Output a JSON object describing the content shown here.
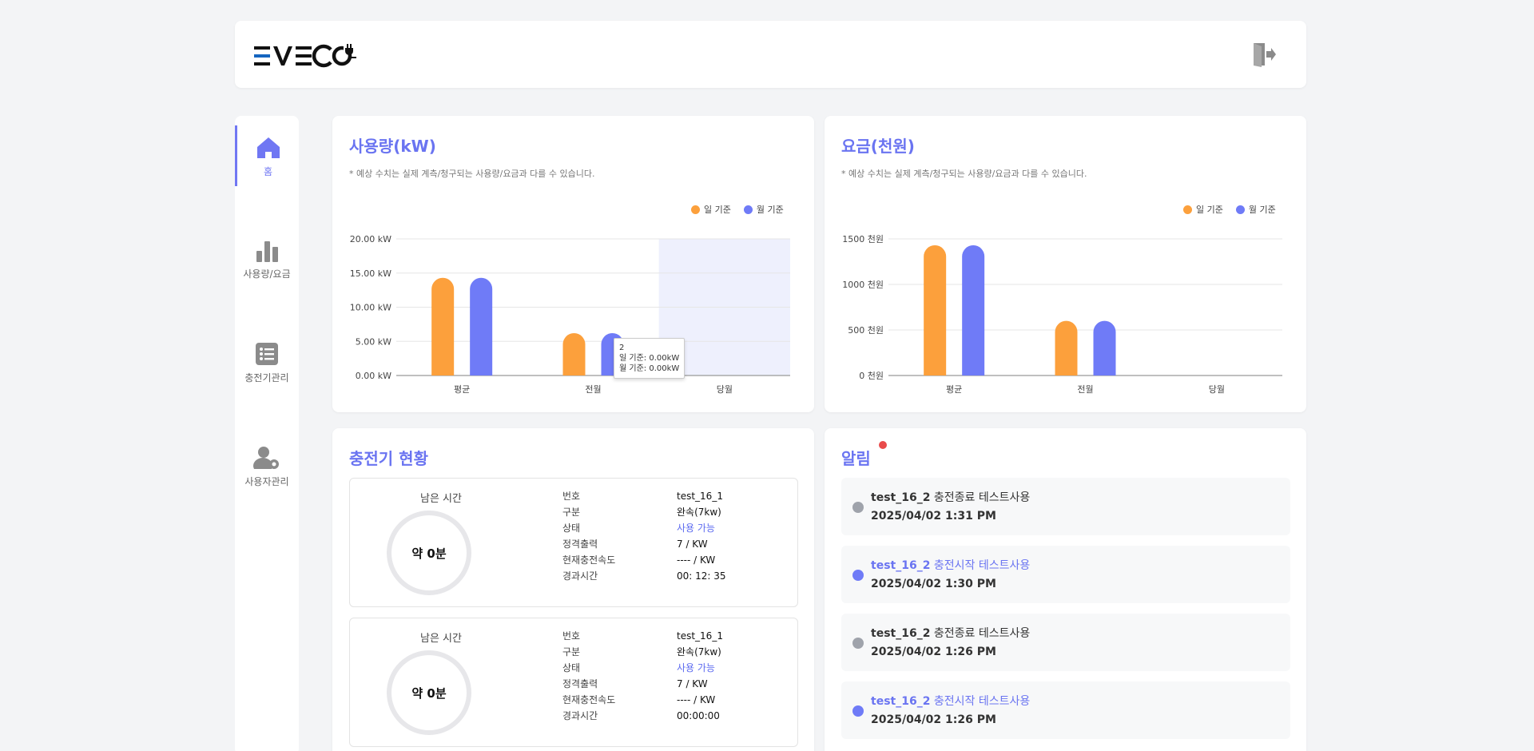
{
  "header": {
    "logo_text": "EVECO",
    "logout_icon": "logout-icon"
  },
  "sidebar": {
    "items": [
      {
        "label": "홈",
        "icon": "home-icon",
        "active": true
      },
      {
        "label": "사용량/요금",
        "icon": "bar-chart-icon",
        "active": false
      },
      {
        "label": "충전기관리",
        "icon": "list-icon",
        "active": false
      },
      {
        "label": "사용자관리",
        "icon": "user-gear-icon",
        "active": false
      }
    ]
  },
  "usage_card": {
    "title": "사용량(kW)",
    "note": "* 예상 수치는 실제 계측/청구되는 사용량/요금과 다를 수 있습니다.",
    "legend": [
      "일 기준",
      "월 기준"
    ],
    "tooltip": {
      "title": "2",
      "line1": "일 기준: 0.00kW",
      "line2": "월 기준: 0.00kW"
    }
  },
  "fee_card": {
    "title": "요금(천원)",
    "note": "* 예상 수치는 실제 계측/청구되는 사용량/요금과 다를 수 있습니다.",
    "legend": [
      "일 기준",
      "월 기준"
    ]
  },
  "chart_data": [
    {
      "type": "bar",
      "title": "사용량(kW)",
      "categories": [
        "평균",
        "전월",
        "당월"
      ],
      "series": [
        {
          "name": "일 기준",
          "color": "#fca03c",
          "values": [
            14.3,
            6.2,
            0
          ]
        },
        {
          "name": "월 기준",
          "color": "#6f7bf7",
          "values": [
            14.3,
            6.2,
            0
          ]
        }
      ],
      "yticks": [
        "0.00 kW",
        "5.00 kW",
        "10.00 kW",
        "15.00 kW",
        "20.00 kW"
      ],
      "ylim": [
        0,
        20
      ],
      "legend_position": "top-right",
      "highlight_category": "당월"
    },
    {
      "type": "bar",
      "title": "요금(천원)",
      "categories": [
        "평균",
        "전월",
        "당월"
      ],
      "series": [
        {
          "name": "일 기준",
          "color": "#fca03c",
          "values": [
            1430,
            600,
            0
          ]
        },
        {
          "name": "월 기준",
          "color": "#6f7bf7",
          "values": [
            1430,
            600,
            0
          ]
        }
      ],
      "yticks": [
        "0 천원",
        "500 천원",
        "1000 천원",
        "1500 천원"
      ],
      "ylim": [
        0,
        1500
      ],
      "legend_position": "top-right"
    }
  ],
  "charger_card": {
    "title": "충전기 현황",
    "chargers": [
      {
        "remain_label": "남은 시간",
        "remain_value": "약 0분",
        "rows": [
          {
            "k": "번호",
            "v": "test_16_1"
          },
          {
            "k": "구분",
            "v": "완속(7kw)"
          },
          {
            "k": "상태",
            "v": "사용 가능",
            "blue": true
          },
          {
            "k": "정격출력",
            "v": "7 / KW"
          },
          {
            "k": "현재충전속도",
            "v": "---- / KW"
          },
          {
            "k": "경과시간",
            "v": "00: 12: 35"
          }
        ]
      },
      {
        "remain_label": "남은 시간",
        "remain_value": "약 0분",
        "rows": [
          {
            "k": "번호",
            "v": "test_16_1"
          },
          {
            "k": "구분",
            "v": "완속(7kw)"
          },
          {
            "k": "상태",
            "v": "사용 가능",
            "blue": true
          },
          {
            "k": "정격출력",
            "v": "7 / KW"
          },
          {
            "k": "현재충전속도",
            "v": "---- / KW"
          },
          {
            "k": "경과시간",
            "v": "00:00:00"
          }
        ]
      }
    ]
  },
  "alert_card": {
    "title": "알림",
    "items": [
      {
        "device": "test_16_2",
        "text": " 충전종료 테스트사용",
        "time": "2025/04/02 1:31 PM",
        "color": "#9fa3ab",
        "blue": false
      },
      {
        "device": "test_16_2",
        "text": " 충전시작 테스트사용",
        "time": "2025/04/02 1:30 PM",
        "color": "#6f7bf7",
        "blue": true
      },
      {
        "device": "test_16_2",
        "text": " 충전종료 테스트사용",
        "time": "2025/04/02 1:26 PM",
        "color": "#9fa3ab",
        "blue": false
      },
      {
        "device": "test_16_2",
        "text": " 충전시작 테스트사용",
        "time": "2025/04/02 1:26 PM",
        "color": "#6f7bf7",
        "blue": true
      }
    ]
  }
}
